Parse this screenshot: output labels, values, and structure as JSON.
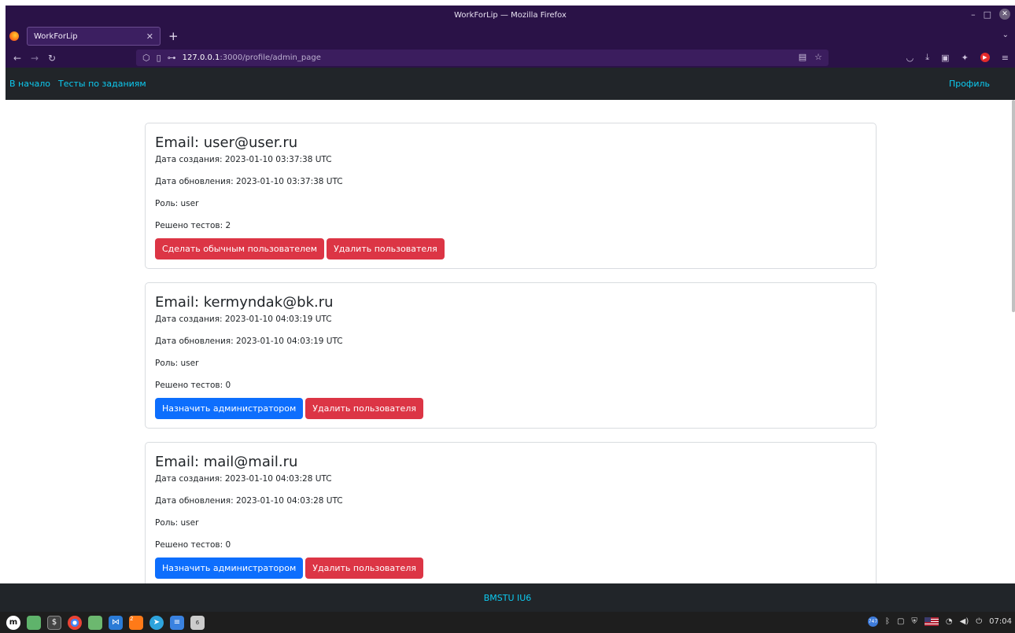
{
  "window": {
    "title": "WorkForLip — Mozilla Firefox",
    "close_icon": "✕"
  },
  "browser": {
    "tab_title": "WorkForLip",
    "url_host": "127.0.0.1",
    "url_path": ":3000/profile/admin_page"
  },
  "nav": {
    "home": "В начало",
    "tests": "Тесты по заданиям",
    "profile": "Профиль"
  },
  "users": [
    {
      "email": "Email: user@user.ru",
      "created": "Дата создания: 2023-01-10 03:37:38 UTC",
      "updated": "Дата обновления: 2023-01-10 03:37:38 UTC",
      "role": "Роль: user",
      "solved": "Решено тестов: 2",
      "primary_label": "Сделать обычным пользователем",
      "primary_color": "#dc3545",
      "delete_label": "Удалить пользователя"
    },
    {
      "email": "Email: kermyndak@bk.ru",
      "created": "Дата создания: 2023-01-10 04:03:19 UTC",
      "updated": "Дата обновления: 2023-01-10 04:03:19 UTC",
      "role": "Роль: user",
      "solved": "Решено тестов: 0",
      "primary_label": "Назначить администратором",
      "primary_color": "#0d6efd",
      "delete_label": "Удалить пользователя"
    },
    {
      "email": "Email: mail@mail.ru",
      "created": "Дата создания: 2023-01-10 04:03:28 UTC",
      "updated": "Дата обновления: 2023-01-10 04:03:28 UTC",
      "role": "Роль: user",
      "solved": "Решено тестов: 0",
      "primary_label": "Назначить администратором",
      "primary_color": "#0d6efd",
      "delete_label": "Удалить пользователя"
    }
  ],
  "footer": {
    "text": "BMSTU IU6"
  },
  "taskbar": {
    "clock": "07:04",
    "badge_workspace": "2",
    "badge_screenshot": "6",
    "badge_tray": "747"
  }
}
